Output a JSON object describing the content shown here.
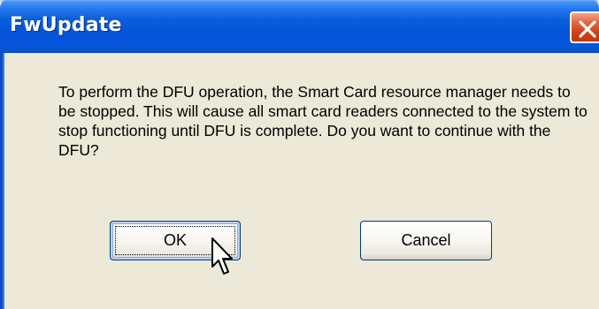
{
  "window": {
    "title": "FwUpdate"
  },
  "message": "To perform the DFU operation, the Smart Card resource manager needs to be stopped. This will cause all smart card readers connected to the system to stop functioning until DFU is complete. Do you want to continue with the DFU?",
  "buttons": {
    "ok_label": "OK",
    "cancel_label": "Cancel"
  },
  "icons": {
    "close": "close-icon",
    "cursor": "mouse-pointer-icon"
  },
  "colors": {
    "titlebar": "#0654d6",
    "close_button": "#d4502a",
    "dialog_background": "#ece9d8"
  }
}
